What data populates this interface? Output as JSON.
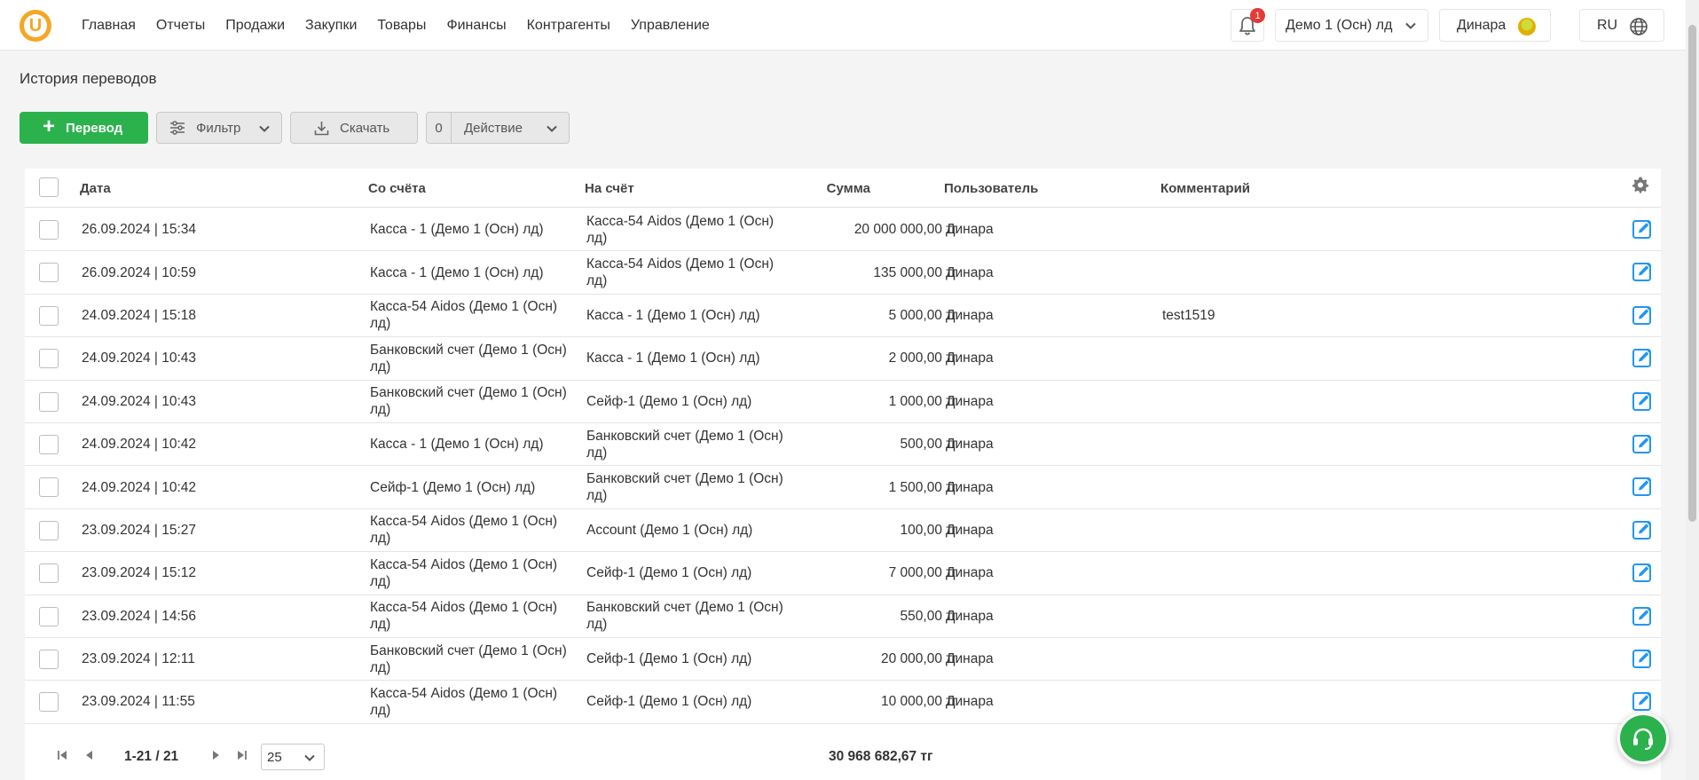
{
  "app": {
    "logo_letter": "U",
    "brand_color": "#f5a623",
    "accent_color": "#2bb24c"
  },
  "nav": {
    "items": [
      "Главная",
      "Отчеты",
      "Продажи",
      "Закупки",
      "Товары",
      "Финансы",
      "Контрагенты",
      "Управление"
    ]
  },
  "header": {
    "notifications_count": "1",
    "organization": "Демо 1 (Осн) лд",
    "user_name": "Динара",
    "language": "RU"
  },
  "page": {
    "title": "История переводов"
  },
  "toolbar": {
    "transfer_label": "Перевод",
    "filter_label": "Фильтр",
    "download_label": "Скачать",
    "action_count": "0",
    "action_label": "Действие"
  },
  "table": {
    "columns": {
      "date": "Дата",
      "from": "Со счёта",
      "to": "На счёт",
      "amount": "Сумма",
      "user": "Пользователь",
      "comment": "Комментарий"
    },
    "rows": [
      {
        "date": "26.09.2024 | 15:34",
        "from": "Касса - 1 (Демо 1 (Осн) лд)",
        "to": "Касса-54 Aidos (Демо 1 (Осн) лд)",
        "amount": "20 000 000,00 тг",
        "user": "Динара",
        "comment": ""
      },
      {
        "date": "26.09.2024 | 10:59",
        "from": "Касса - 1 (Демо 1 (Осн) лд)",
        "to": "Касса-54 Aidos (Демо 1 (Осн) лд)",
        "amount": "135 000,00 тг",
        "user": "Динара",
        "comment": ""
      },
      {
        "date": "24.09.2024 | 15:18",
        "from": "Касса-54 Aidos (Демо 1 (Осн) лд)",
        "to": "Касса - 1 (Демо 1 (Осн) лд)",
        "amount": "5 000,00 тг",
        "user": "Динара",
        "comment": "test1519"
      },
      {
        "date": "24.09.2024 | 10:43",
        "from": "Банковский счет (Демо 1 (Осн) лд)",
        "to": "Касса - 1 (Демо 1 (Осн) лд)",
        "amount": "2 000,00 тг",
        "user": "Динара",
        "comment": ""
      },
      {
        "date": "24.09.2024 | 10:43",
        "from": "Банковский счет (Демо 1 (Осн) лд)",
        "to": "Сейф-1 (Демо 1 (Осн) лд)",
        "amount": "1 000,00 тг",
        "user": "Динара",
        "comment": ""
      },
      {
        "date": "24.09.2024 | 10:42",
        "from": "Касса - 1 (Демо 1 (Осн) лд)",
        "to": "Банковский счет (Демо 1 (Осн) лд)",
        "amount": "500,00 тг",
        "user": "Динара",
        "comment": ""
      },
      {
        "date": "24.09.2024 | 10:42",
        "from": "Сейф-1 (Демо 1 (Осн) лд)",
        "to": "Банковский счет (Демо 1 (Осн) лд)",
        "amount": "1 500,00 тг",
        "user": "Динара",
        "comment": ""
      },
      {
        "date": "23.09.2024 | 15:27",
        "from": "Касса-54 Aidos (Демо 1 (Осн) лд)",
        "to": "Account (Демо 1 (Осн) лд)",
        "amount": "100,00 тг",
        "user": "Динара",
        "comment": ""
      },
      {
        "date": "23.09.2024 | 15:12",
        "from": "Касса-54 Aidos (Демо 1 (Осн) лд)",
        "to": "Сейф-1 (Демо 1 (Осн) лд)",
        "amount": "7 000,00 тг",
        "user": "Динара",
        "comment": ""
      },
      {
        "date": "23.09.2024 | 14:56",
        "from": "Касса-54 Aidos (Демо 1 (Осн) лд)",
        "to": "Банковский счет (Демо 1 (Осн) лд)",
        "amount": "550,00 тг",
        "user": "Динара",
        "comment": ""
      },
      {
        "date": "23.09.2024 | 12:11",
        "from": "Банковский счет (Демо 1 (Осн) лд)",
        "to": "Сейф-1 (Демо 1 (Осн) лд)",
        "amount": "20 000,00 тг",
        "user": "Динара",
        "comment": ""
      },
      {
        "date": "23.09.2024 | 11:55",
        "from": "Касса-54 Aidos (Демо 1 (Осн) лд)",
        "to": "Сейф-1 (Демо 1 (Осн) лд)",
        "amount": "10 000,00 тг",
        "user": "Динара",
        "comment": ""
      }
    ]
  },
  "pagination": {
    "range": "1-21 / 21",
    "page_size": "25",
    "total": "30 968 682,67 тг"
  },
  "icons": {
    "notification": "bell-icon",
    "language": "globe-icon",
    "settings": "gear-icon",
    "edit": "edit-icon",
    "support": "headset-icon"
  }
}
